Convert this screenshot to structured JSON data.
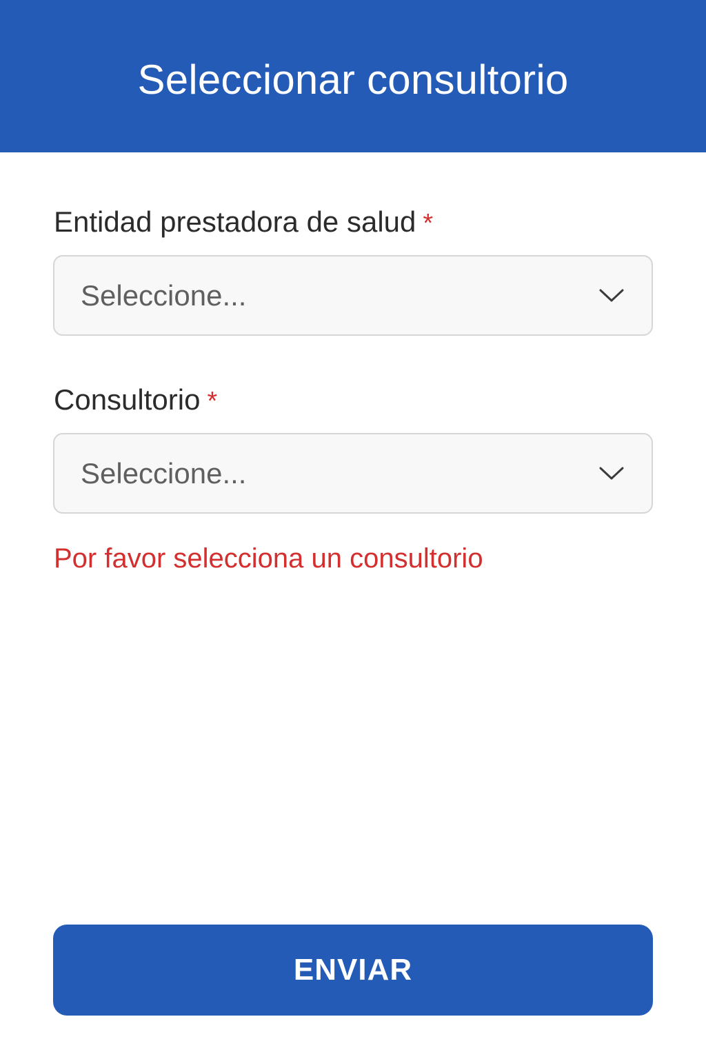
{
  "header": {
    "title": "Seleccionar consultorio"
  },
  "form": {
    "entidad": {
      "label": "Entidad prestadora de salud",
      "required_marker": "*",
      "placeholder": "Seleccione...",
      "icon": "chevron-down-icon"
    },
    "consultorio": {
      "label": "Consultorio",
      "required_marker": "*",
      "placeholder": "Seleccione...",
      "icon": "chevron-down-icon"
    },
    "error_message": "Por favor selecciona un consultorio",
    "submit_label": "ENVIAR"
  },
  "colors": {
    "primary": "#235bb7",
    "error": "#d32f2f",
    "field_background": "#f8f8f8",
    "field_border": "#d6d6d6"
  }
}
